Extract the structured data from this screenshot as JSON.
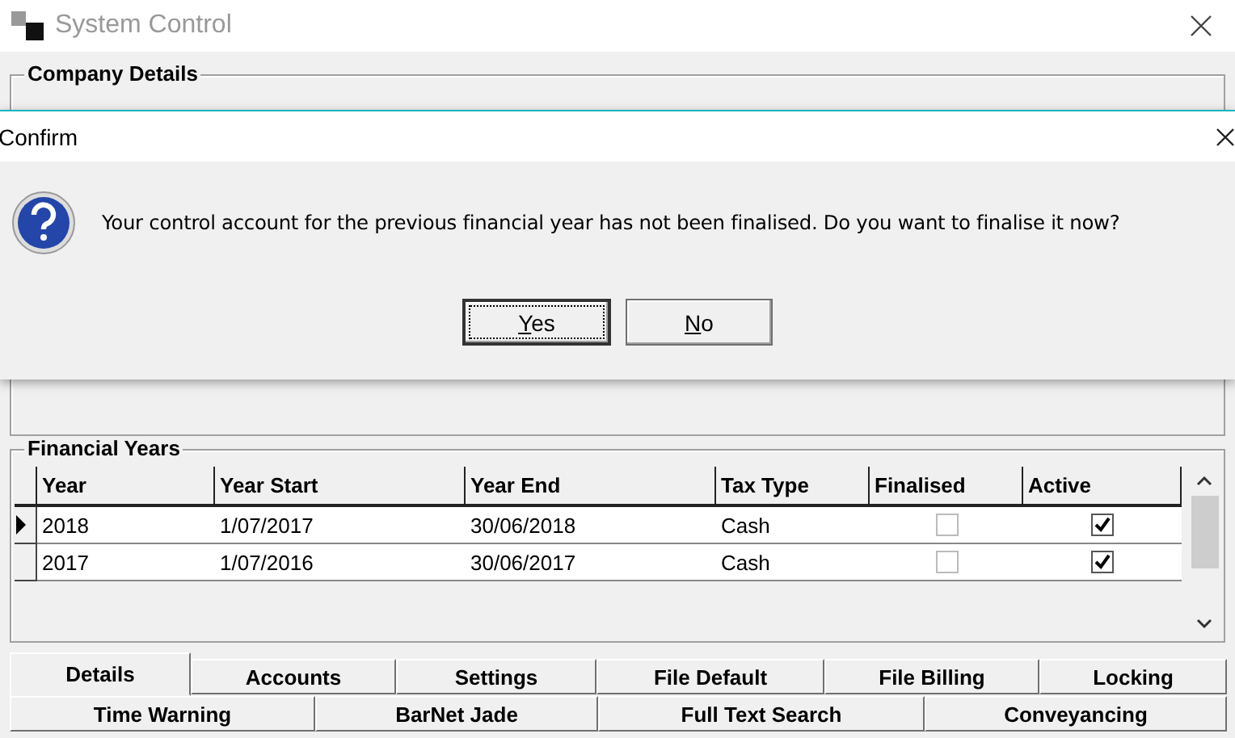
{
  "window": {
    "title": "System Control"
  },
  "company_details": {
    "title": "Company Details"
  },
  "dialog": {
    "title": "Confirm",
    "message": "Your control account for the previous financial year has not been finalised. Do you want to finalise it now?",
    "buttons": [
      {
        "label": "Yes",
        "default": true
      },
      {
        "label": "No",
        "default": false
      }
    ]
  },
  "financial_years": {
    "title": "Financial Years",
    "columns": [
      "Year",
      "Year Start",
      "Year End",
      "Tax Type",
      "Finalised",
      "Active"
    ],
    "rows": [
      {
        "year": "2018",
        "year_start": "1/07/2017",
        "year_end": "30/06/2018",
        "tax_type": "Cash",
        "finalised": false,
        "active": true,
        "selected": true
      },
      {
        "year": "2017",
        "year_start": "1/07/2016",
        "year_end": "30/06/2017",
        "tax_type": "Cash",
        "finalised": false,
        "active": true,
        "selected": false
      }
    ]
  },
  "tab_rows": [
    {
      "tabs": [
        {
          "label": "Details",
          "selected": true
        },
        {
          "label": "Accounts",
          "selected": false
        },
        {
          "label": "Settings",
          "selected": false
        },
        {
          "label": "File Default",
          "selected": false
        },
        {
          "label": "File Billing",
          "selected": false
        },
        {
          "label": "Locking",
          "selected": false
        }
      ]
    },
    {
      "tabs": [
        {
          "label": "Time Warning",
          "selected": false
        },
        {
          "label": "BarNet Jade",
          "selected": false
        },
        {
          "label": "Full Text Search",
          "selected": false
        },
        {
          "label": "Conveyancing",
          "selected": false
        }
      ]
    }
  ]
}
